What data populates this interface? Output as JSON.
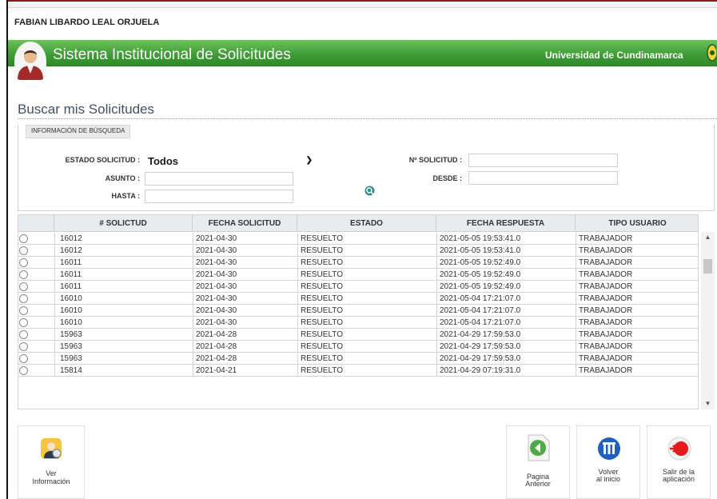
{
  "user": {
    "name": "FABIAN LIBARDO LEAL ORJUELA"
  },
  "header": {
    "title": "Sistema Institucional de Solicitudes",
    "institution": "Universidad de Cundinamarca",
    "colors": {
      "banner": "#3e9b35",
      "accent": "#8a1c1c"
    }
  },
  "page": {
    "title": "Buscar mis Solicitudes"
  },
  "search": {
    "legend": "INFORMACIÓN DE BÚSQUEDA",
    "estado_label": "ESTADO SOLICITUD :",
    "estado_value": "Todos",
    "asunto_label": "ASUNTO :",
    "asunto_value": "",
    "hasta_label": "HASTA :",
    "hasta_value": "",
    "numero_label": "Nº SOLICITUD :",
    "numero_value": "",
    "desde_label": "DESDE :",
    "desde_value": "",
    "search_icon": "search-icon"
  },
  "table": {
    "columns": [
      "# SOLICTUD",
      "FECHA SOLICITUD",
      "ESTADO",
      "FECHA RESPUESTA",
      "TIPO USUARIO"
    ],
    "rows": [
      [
        "16012",
        "2021-04-30",
        "RESUELTO",
        "2021-05-05 19:53:41.0",
        "TRABAJADOR"
      ],
      [
        "16012",
        "2021-04-30",
        "RESUELTO",
        "2021-05-05 19:53:41.0",
        "TRABAJADOR"
      ],
      [
        "16011",
        "2021-04-30",
        "RESUELTO",
        "2021-05-05 19:52:49.0",
        "TRABAJADOR"
      ],
      [
        "16011",
        "2021-04-30",
        "RESUELTO",
        "2021-05-05 19:52:49.0",
        "TRABAJADOR"
      ],
      [
        "16011",
        "2021-04-30",
        "RESUELTO",
        "2021-05-05 19:52:49.0",
        "TRABAJADOR"
      ],
      [
        "16010",
        "2021-04-30",
        "RESUELTO",
        "2021-05-04 17:21:07.0",
        "TRABAJADOR"
      ],
      [
        "16010",
        "2021-04-30",
        "RESUELTO",
        "2021-05-04 17:21:07.0",
        "TRABAJADOR"
      ],
      [
        "16010",
        "2021-04-30",
        "RESUELTO",
        "2021-05-04 17:21:07.0",
        "TRABAJADOR"
      ],
      [
        "15963",
        "2021-04-28",
        "RESUELTO",
        "2021-04-29 17:59:53.0",
        "TRABAJADOR"
      ],
      [
        "15963",
        "2021-04-28",
        "RESUELTO",
        "2021-04-29 17:59:53.0",
        "TRABAJADOR"
      ],
      [
        "15963",
        "2021-04-28",
        "RESUELTO",
        "2021-04-29 17:59:53.0",
        "TRABAJADOR"
      ],
      [
        "15814",
        "2021-04-21",
        "RESUELTO",
        "2021-04-29 07:19:31.0",
        "TRABAJADOR"
      ]
    ]
  },
  "actions": {
    "ver_info": {
      "line1": "Ver",
      "line2": "Información",
      "icon": "user-info-icon"
    },
    "pagina_anterior": {
      "line1": "Pagina",
      "line2": "Anterior",
      "icon": "back-page-icon"
    },
    "volver": {
      "line1": "Volver",
      "line2": "al inicio",
      "icon": "home-icon"
    },
    "salir": {
      "line1": "Salir de la",
      "line2": "aplicación",
      "icon": "exit-icon"
    }
  }
}
